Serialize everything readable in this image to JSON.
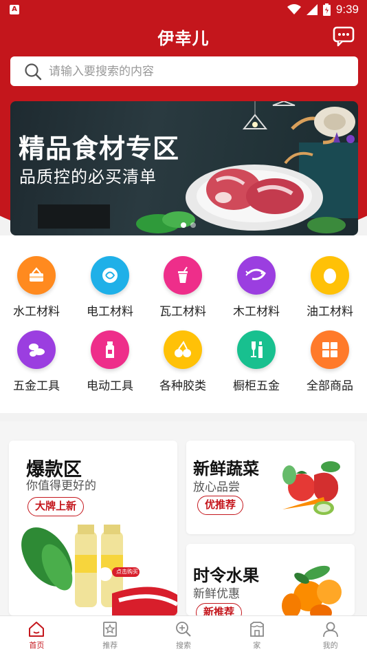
{
  "status_bar": {
    "time": "9:39",
    "notification_glyph": "A"
  },
  "header": {
    "title": "伊幸儿"
  },
  "search": {
    "placeholder": "请输入要搜索的内容"
  },
  "banner": {
    "title": "精品食材专区",
    "subtitle": "品质控的必买清单",
    "slide_count": 2,
    "active_slide": 1
  },
  "categories": [
    {
      "label": "水工材料",
      "color": "#ff8a1f",
      "icon": "basket-icon"
    },
    {
      "label": "电工材料",
      "color": "#1fb0e8",
      "icon": "coconut-icon"
    },
    {
      "label": "瓦工材料",
      "color": "#ee2e8a",
      "icon": "cup-icon"
    },
    {
      "label": "木工材料",
      "color": "#9b3ee0",
      "icon": "shrimp-icon"
    },
    {
      "label": "油工材料",
      "color": "#ffc107",
      "icon": "egg-icon"
    },
    {
      "label": "五金工具",
      "color": "#9b3ee0",
      "icon": "nuts-icon"
    },
    {
      "label": "电动工具",
      "color": "#ee2e8a",
      "icon": "milk-icon"
    },
    {
      "label": "各种胶类",
      "color": "#ffc107",
      "icon": "cherry-icon"
    },
    {
      "label": "橱柜五金",
      "color": "#18c08f",
      "icon": "wine-icon"
    },
    {
      "label": "全部商品",
      "color": "#ff7a2a",
      "icon": "grid-icon"
    }
  ],
  "promos": {
    "hot": {
      "title": "爆款区",
      "subtitle": "你值得更好的",
      "tag": "大牌上新",
      "product_text": "点击购买"
    },
    "veg": {
      "title": "新鲜蔬菜",
      "subtitle": "放心品尝",
      "tag": "优推荐"
    },
    "fruit": {
      "title": "时令水果",
      "subtitle": "新鲜优惠",
      "tag": "新推荐"
    }
  },
  "bottom_nav": [
    {
      "label": "首页",
      "icon": "home-icon",
      "active": true
    },
    {
      "label": "推荐",
      "icon": "star-bookmark-icon",
      "active": false
    },
    {
      "label": "搜索",
      "icon": "search-icon",
      "active": false
    },
    {
      "label": "家",
      "icon": "house-icon",
      "active": false
    },
    {
      "label": "我的",
      "icon": "user-icon",
      "active": false
    }
  ],
  "colors": {
    "brand_red": "#c4161c",
    "nav_inactive": "#888888"
  }
}
